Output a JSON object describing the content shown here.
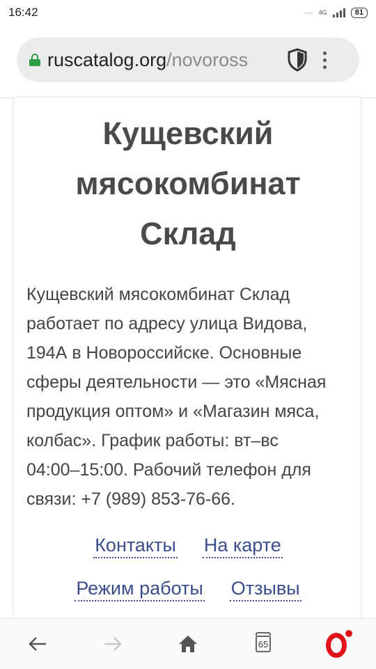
{
  "status_bar": {
    "time": "16:42",
    "network": "4G",
    "battery": "81"
  },
  "browser": {
    "url_host": "ruscatalog.org",
    "url_path": "/novoross"
  },
  "page": {
    "title_lines": [
      "Кущевский",
      "мясокомбинат",
      "Склад"
    ],
    "description_lines": [
      "Кущевский мясокомбинат Склад",
      "работает по адресу улица Видова,",
      "194А в Новороссийске. Основные",
      "сферы деятельности — это «Мясная",
      "продукция оптом» и «Магазин мяса,",
      "колбас». График работы: вт–вс",
      "04:00–15:00. Рабочий телефон для",
      "связи: +7 (989) 853-76-66."
    ],
    "links": {
      "contacts": "Контакты",
      "map": "На карте",
      "hours": "Режим работы",
      "reviews": "Отзывы"
    }
  },
  "bottom_nav": {
    "tab_count": "65",
    "icons": [
      "back-arrow-icon",
      "forward-arrow-icon",
      "home-icon",
      "tabs-icon",
      "opera-logo-icon"
    ]
  },
  "colors": {
    "link": "#3c4d8c",
    "lock": "#2e9d45",
    "opera": "#e2141b"
  }
}
